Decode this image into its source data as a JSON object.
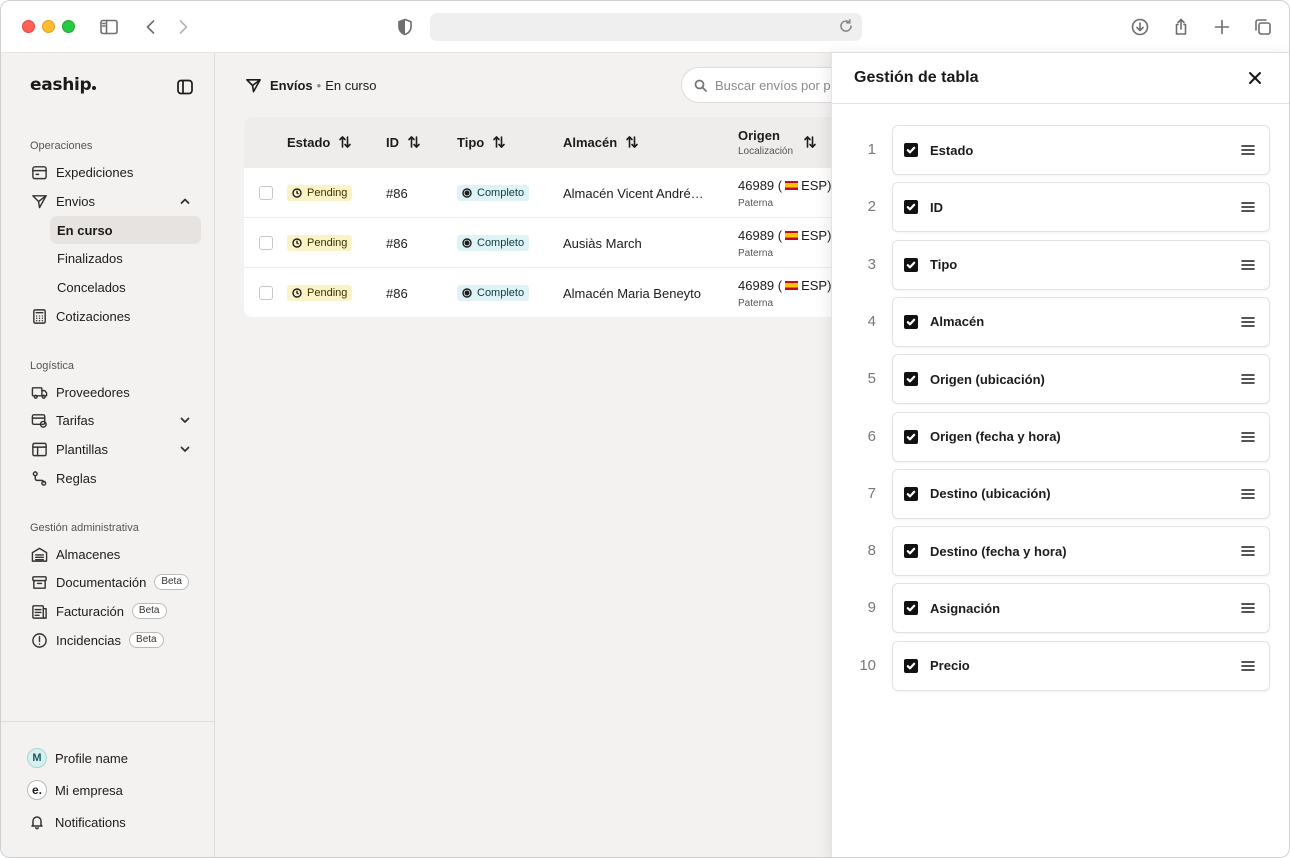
{
  "browser": {
    "url": ""
  },
  "sidebar": {
    "logo": "eaship",
    "sections": [
      {
        "title": "Operaciones"
      },
      {
        "title": "Logística"
      },
      {
        "title": "Gestión administrativa"
      }
    ],
    "items": {
      "expediciones": "Expediciones",
      "envios": "Envios",
      "en_curso": "En curso",
      "finalizados": "Finalizados",
      "concelados": "Concelados",
      "cotizaciones": "Cotizaciones",
      "proveedores": "Proveedores",
      "tarifas": "Tarifas",
      "plantillas": "Plantillas",
      "reglas": "Reglas",
      "almacenes": "Almacenes",
      "documentacion": "Documentación",
      "facturacion": "Facturación",
      "incidencias": "Incidencias",
      "beta": "Beta"
    },
    "footer": {
      "profile_initial": "M",
      "profile": "Profile name",
      "company_initial": "e.",
      "company": "Mi empresa",
      "notifications": "Notifications"
    }
  },
  "main": {
    "breadcrumb": {
      "section": "Envíos",
      "separator": "•",
      "current": "En curso"
    },
    "search": {
      "placeholder": "Buscar envíos por palabra clave",
      "value": ""
    },
    "table": {
      "headers": {
        "estado": "Estado",
        "id": "ID",
        "tipo": "Tipo",
        "almacen": "Almacén",
        "origen": "Origen",
        "origen_sub": "Localización"
      },
      "rows": [
        {
          "estado": "Pending",
          "id": "#86",
          "tipo": "Completo",
          "almacen": "Almacén Vicent André…",
          "origen_cp": "46989 (",
          "origen_country": "ESP)",
          "origen_city": "Paterna"
        },
        {
          "estado": "Pending",
          "id": "#86",
          "tipo": "Completo",
          "almacen": "Ausiàs March",
          "origen_cp": "46989 (",
          "origen_country": "ESP)",
          "origen_city": "Paterna"
        },
        {
          "estado": "Pending",
          "id": "#86",
          "tipo": "Completo",
          "almacen": "Almacén Maria Beneyto",
          "origen_cp": "46989 (",
          "origen_country": "ESP)",
          "origen_city": "Paterna"
        }
      ]
    }
  },
  "panel": {
    "title": "Gestión de tabla",
    "columns": [
      {
        "index": "1",
        "label": "Estado",
        "checked": true
      },
      {
        "index": "2",
        "label": "ID",
        "checked": true
      },
      {
        "index": "3",
        "label": "Tipo",
        "checked": true
      },
      {
        "index": "4",
        "label": "Almacén",
        "checked": true
      },
      {
        "index": "5",
        "label": "Origen (ubicación)",
        "checked": true
      },
      {
        "index": "6",
        "label": "Origen (fecha y hora)",
        "checked": true
      },
      {
        "index": "7",
        "label": "Destino (ubicación)",
        "checked": true
      },
      {
        "index": "8",
        "label": "Destino (fecha y hora)",
        "checked": true
      },
      {
        "index": "9",
        "label": "Asignación",
        "checked": true
      },
      {
        "index": "10",
        "label": "Precio",
        "checked": true
      }
    ]
  },
  "colors": {
    "pending_bg": "#fbf3c8",
    "complete_bg": "#dff3f6",
    "sidebar_bg": "#f4f2f1",
    "active_item_bg": "#e6e3e0"
  }
}
